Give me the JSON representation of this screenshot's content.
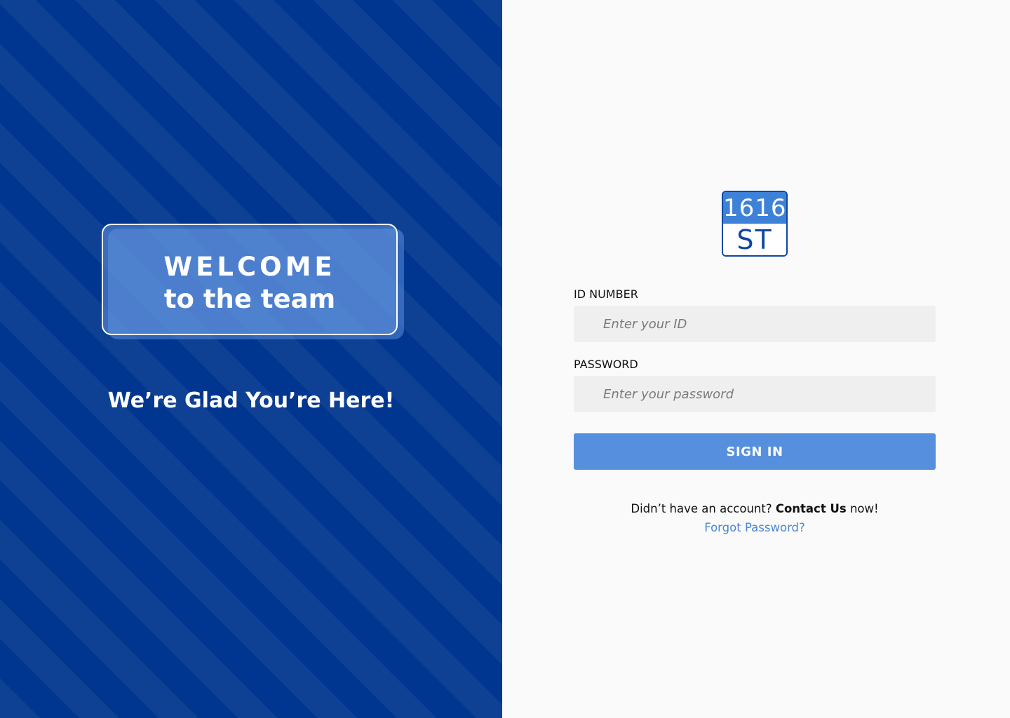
{
  "welcome_panel": {
    "title": "WELCOME",
    "subtitle": "to the team",
    "tagline": "We’re Glad You’re Here!"
  },
  "logo": {
    "top_text": "1616",
    "bottom_text": "ST"
  },
  "login_form": {
    "id_label": "ID NUMBER",
    "id_placeholder": "Enter your ID",
    "password_label": "PASSWORD",
    "password_placeholder": "Enter your password",
    "sign_in_label": "SIGN IN",
    "account_prefix": "Didn’t have an account?",
    "contact_link": "Contact Us",
    "account_suffix": "now!",
    "forgot_password": "Forgot Password?"
  },
  "colors": {
    "left_background": "#00368f",
    "left_stripe": "#0e4193",
    "right_background": "#fafafa",
    "button": "#568fde",
    "link": "#4a86d4",
    "logo_border": "#0d47a1",
    "logo_top": "#3d82d8"
  }
}
